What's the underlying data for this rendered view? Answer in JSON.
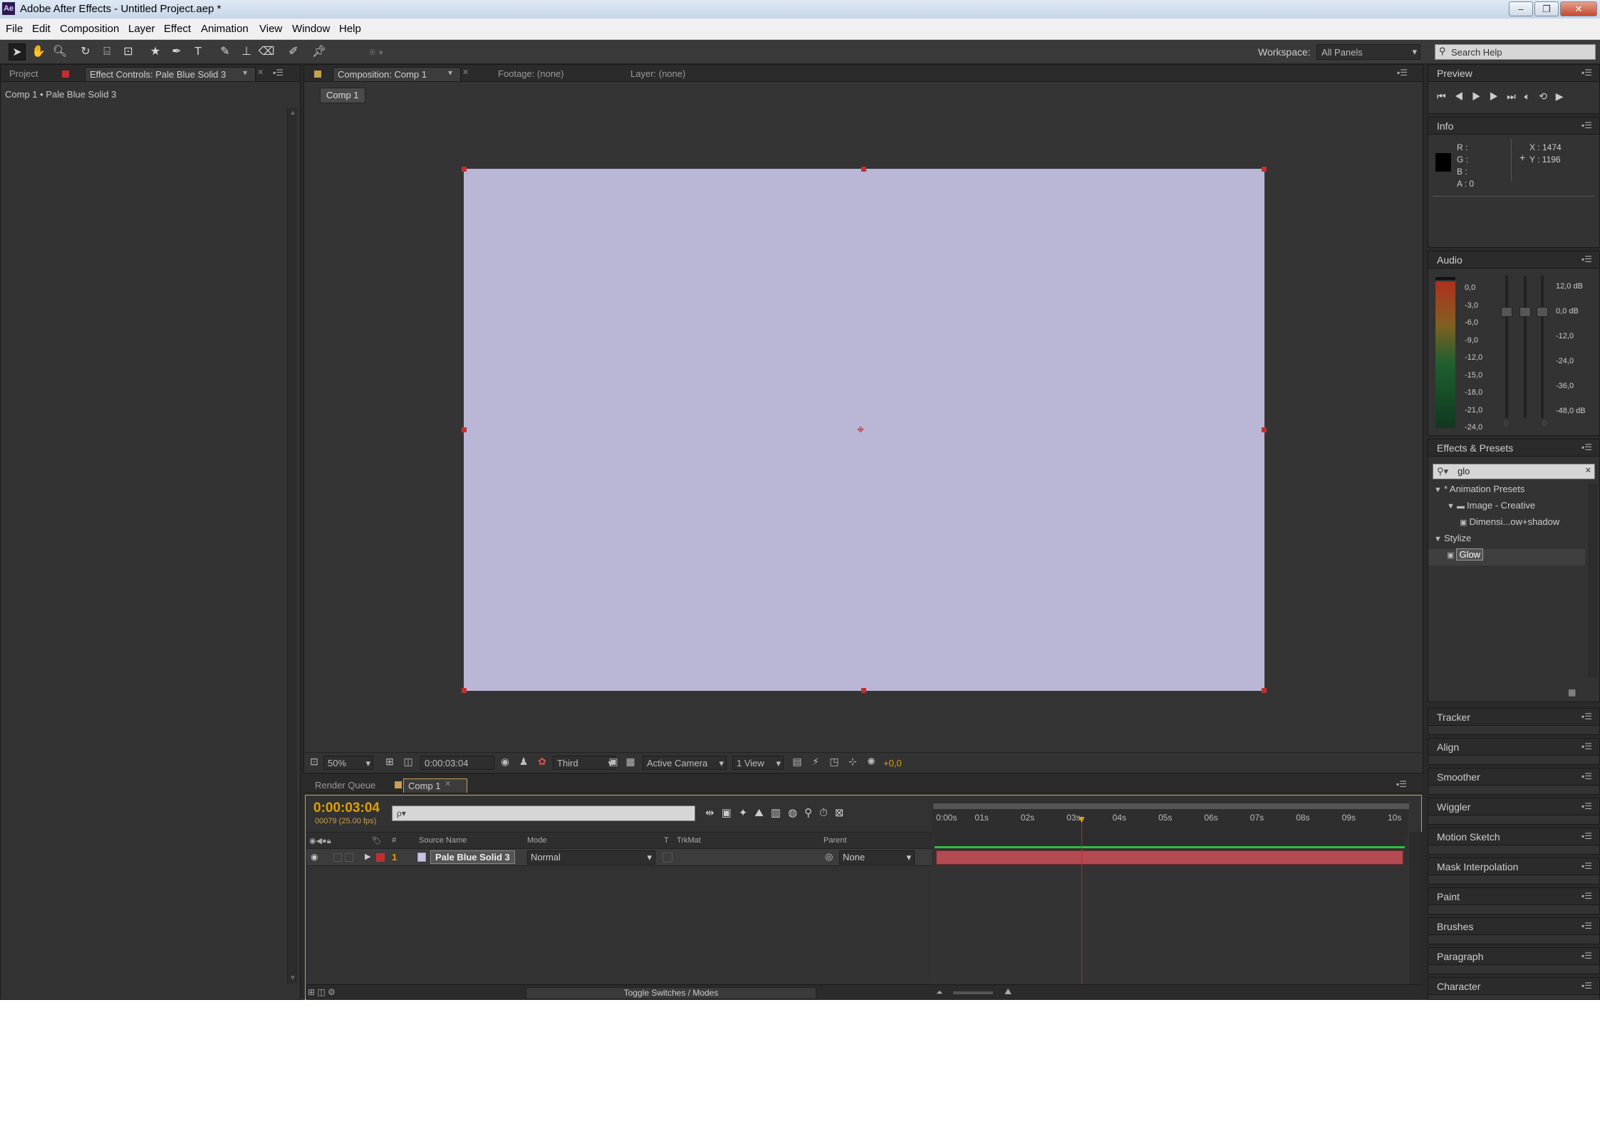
{
  "window": {
    "title": "Adobe After Effects - Untitled Project.aep *",
    "app_icon": "Ae",
    "minimize": "–",
    "restore": "❐",
    "close": "✕"
  },
  "menu": [
    "File",
    "Edit",
    "Composition",
    "Layer",
    "Effect",
    "Animation",
    "View",
    "Window",
    "Help"
  ],
  "toolbar": {
    "workspace_label": "Workspace:",
    "workspace_value": "All Panels",
    "search_placeholder": "Search Help"
  },
  "left_panel": {
    "tab_project": "Project",
    "tab_effect_controls": "Effect Controls: Pale Blue Solid 3",
    "breadcrumb": "Comp 1 • Pale Blue Solid 3"
  },
  "viewer": {
    "tab_composition": "Composition: Comp 1",
    "tab_footage": "Footage: (none)",
    "tab_layer": "Layer: (none)",
    "comp_button": "Comp 1",
    "canvas_color": "#bab6d6"
  },
  "viewer_bar": {
    "zoom": "50%",
    "timecode": "0:00:03:04",
    "resolution": "Third",
    "camera": "Active Camera",
    "views": "1 View",
    "exposure": "+0,0"
  },
  "timeline": {
    "tab_render_queue": "Render Queue",
    "tab_comp": "Comp 1",
    "timecode": "0:00:03:04",
    "frames": "00079 (25.00 fps)",
    "search_placeholder": "ρ▾",
    "columns": {
      "num": "#",
      "source": "Source Name",
      "mode": "Mode",
      "t": "T",
      "trkmat": "TrkMat",
      "parent": "Parent"
    },
    "ruler": [
      "0:00s",
      "01s",
      "02s",
      "03s",
      "04s",
      "05s",
      "06s",
      "07s",
      "08s",
      "09s",
      "10s"
    ],
    "playhead_seconds": 3.16,
    "layer": {
      "index": "1",
      "name": "Pale Blue Solid 3",
      "mode": "Normal",
      "parent": "None",
      "label_color": "#c03030",
      "swatch_color": "#c8c4e8"
    },
    "toggle": "Toggle Switches / Modes"
  },
  "right": {
    "preview": "Preview",
    "info": {
      "title": "Info",
      "r": "R :",
      "g": "G :",
      "b": "B :",
      "a": "A : 0",
      "x": "X : 1474",
      "y": "Y : 1196"
    },
    "audio": {
      "title": "Audio",
      "left_scale": [
        "0,0",
        "-3,0",
        "-6,0",
        "-9,0",
        "-12,0",
        "-15,0",
        "-18,0",
        "-21,0",
        "-24,0"
      ],
      "right_scale": [
        "12,0 dB",
        "0,0 dB",
        "-12,0",
        "-24,0",
        "-36,0",
        "-48,0 dB"
      ],
      "fader_left": "0",
      "fader_right": "0"
    },
    "effects": {
      "title": "Effects & Presets",
      "search": "glo",
      "items": [
        {
          "label": "* Animation Presets",
          "depth": 0
        },
        {
          "label": "Image - Creative",
          "depth": 1
        },
        {
          "label": "Dimensi...ow+shadow",
          "depth": 2
        },
        {
          "label": "Stylize",
          "depth": 0
        },
        {
          "label": "Glow",
          "depth": 1
        }
      ]
    },
    "collapsed": [
      "Tracker",
      "Align",
      "Smoother",
      "Wiggler",
      "Motion Sketch",
      "Mask Interpolation",
      "Paint",
      "Brushes",
      "Paragraph",
      "Character"
    ]
  }
}
